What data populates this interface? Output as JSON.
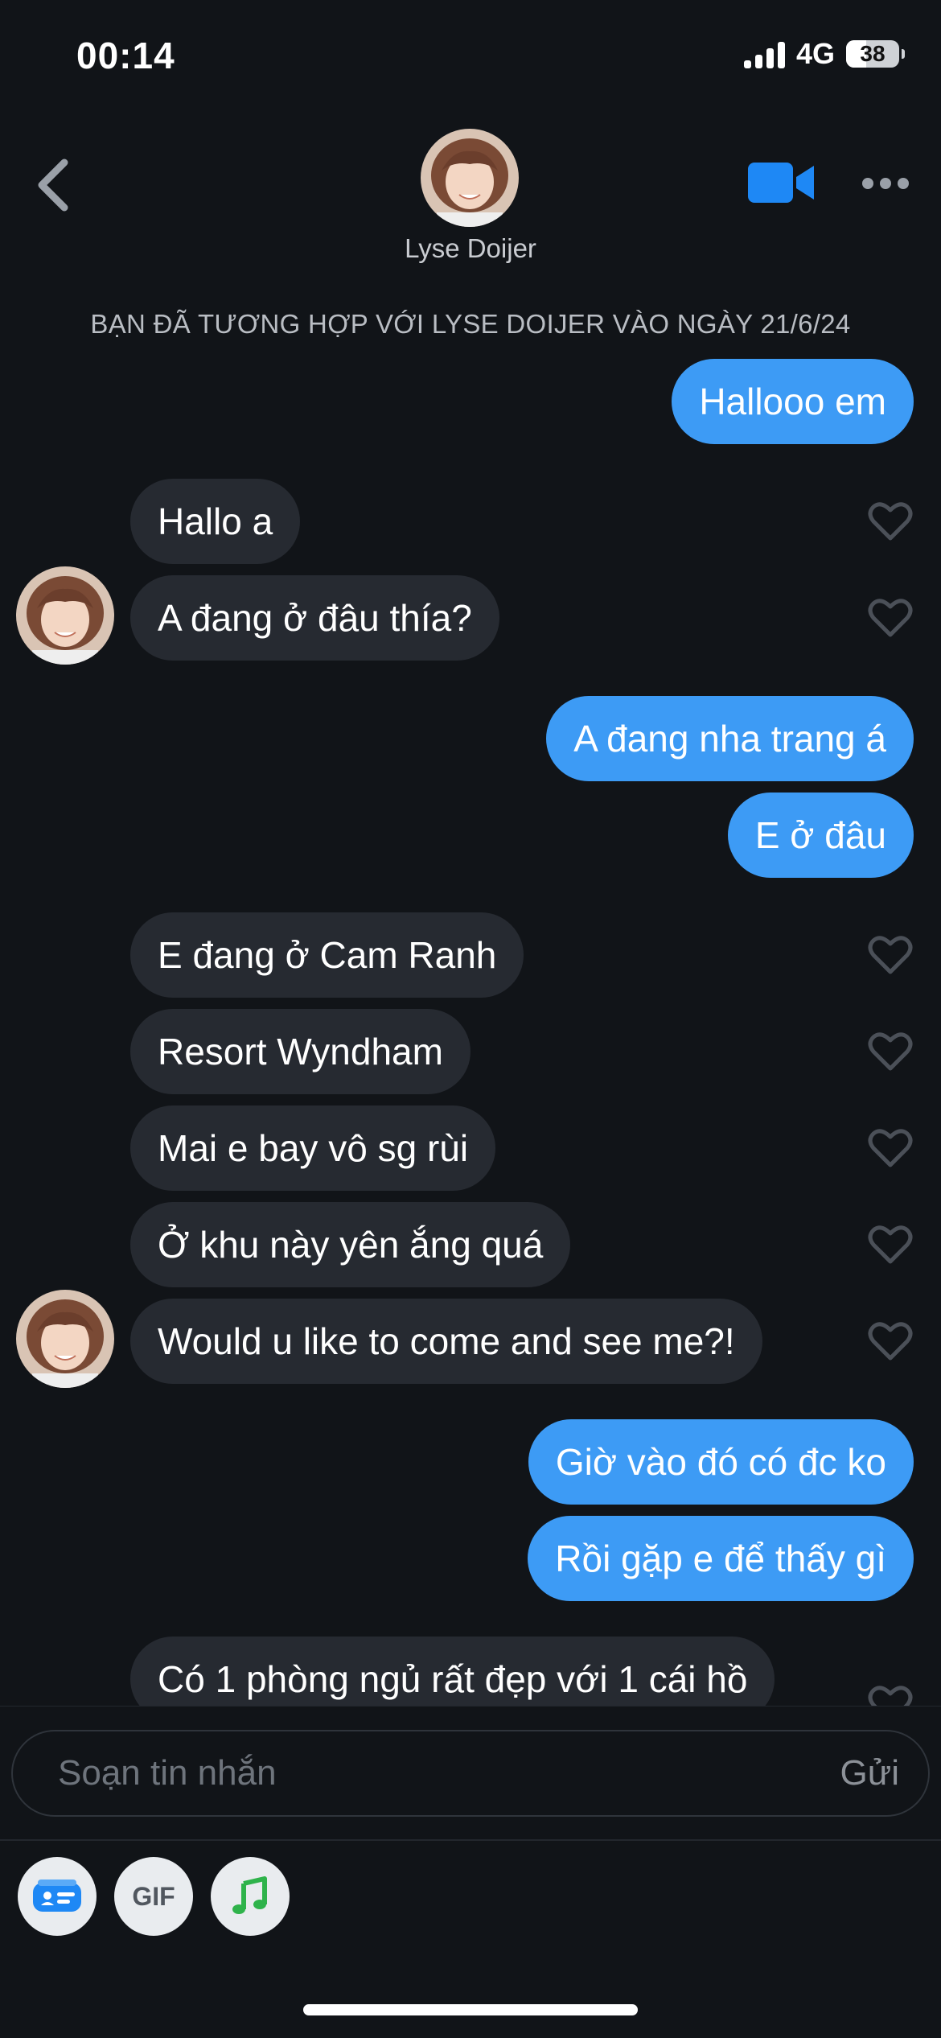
{
  "status_bar": {
    "time": "00:14",
    "network": "4G",
    "battery": "38"
  },
  "header": {
    "name": "Lyse Doijer",
    "icons": [
      "back-icon",
      "video-call-icon",
      "more-icon"
    ]
  },
  "match_note": "BẠN ĐÃ TƯƠNG HỢP VỚI LYSE DOIJER VÀO NGÀY 21/6/24",
  "messages": [
    {
      "from": "me",
      "text": "Hallooo em"
    },
    {
      "from": "her",
      "text": "Hallo a"
    },
    {
      "from": "her",
      "text": "A đang ở đâu thía?"
    },
    {
      "from": "me",
      "text": "A đang nha trang á"
    },
    {
      "from": "me",
      "text": "E ở đâu"
    },
    {
      "from": "her",
      "text": "E đang ở Cam Ranh"
    },
    {
      "from": "her",
      "text": "Resort Wyndham"
    },
    {
      "from": "her",
      "text": "Mai e bay vô sg rùi"
    },
    {
      "from": "her",
      "text": "Ở khu này yên ắng quá"
    },
    {
      "from": "her",
      "text": "Would u like to come and see me?!"
    },
    {
      "from": "me",
      "text": "Giờ vào đó có đc ko"
    },
    {
      "from": "me",
      "text": "Rồi gặp e để thấy gì"
    },
    {
      "from": "her",
      "text": "Có 1 phòng ngủ rất đẹp với 1 cái hồ"
    }
  ],
  "composer": {
    "placeholder": "Soạn tin nhắn",
    "send_label": "Gửi"
  },
  "tools": {
    "gif_label": "GIF",
    "icons": [
      "contact-card-icon",
      "gif-icon",
      "music-icon"
    ]
  },
  "colors": {
    "background": "#111418",
    "sent_bubble": "#3d9bf5",
    "received_bubble": "#262a31",
    "accent": "#1e88f5"
  }
}
